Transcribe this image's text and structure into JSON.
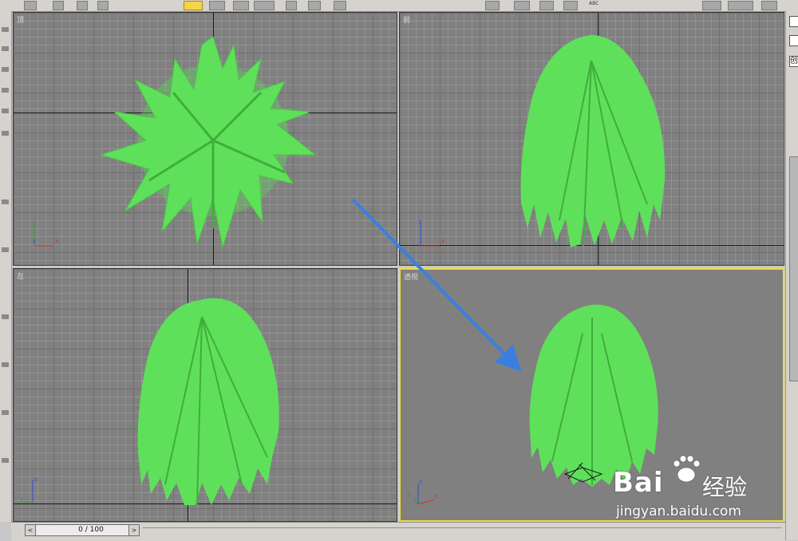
{
  "toolbar": {
    "abc_label": "ABC"
  },
  "viewports": {
    "top": {
      "label": "顶"
    },
    "front": {
      "label": "前"
    },
    "left": {
      "label": "左"
    },
    "perspective": {
      "label": "透视"
    }
  },
  "gizmo": {
    "x": "x",
    "y": "y",
    "z": "z"
  },
  "right_panel": {
    "field_char": "创"
  },
  "timeslider": {
    "text": "0 / 100",
    "prev": "<",
    "next": ">"
  },
  "watermark": {
    "brand": "Bai",
    "sub": "经验",
    "url": "jingyan.baidu.com"
  },
  "colors": {
    "tree": "#5fe05a",
    "selected_border": "#f0dc3a",
    "annotation_arrow": "#3a7fe0"
  },
  "icons": [
    "select-arrow-icon",
    "move-icon",
    "rotate-icon",
    "scale-icon",
    "snap-icon",
    "text-abc-icon"
  ]
}
